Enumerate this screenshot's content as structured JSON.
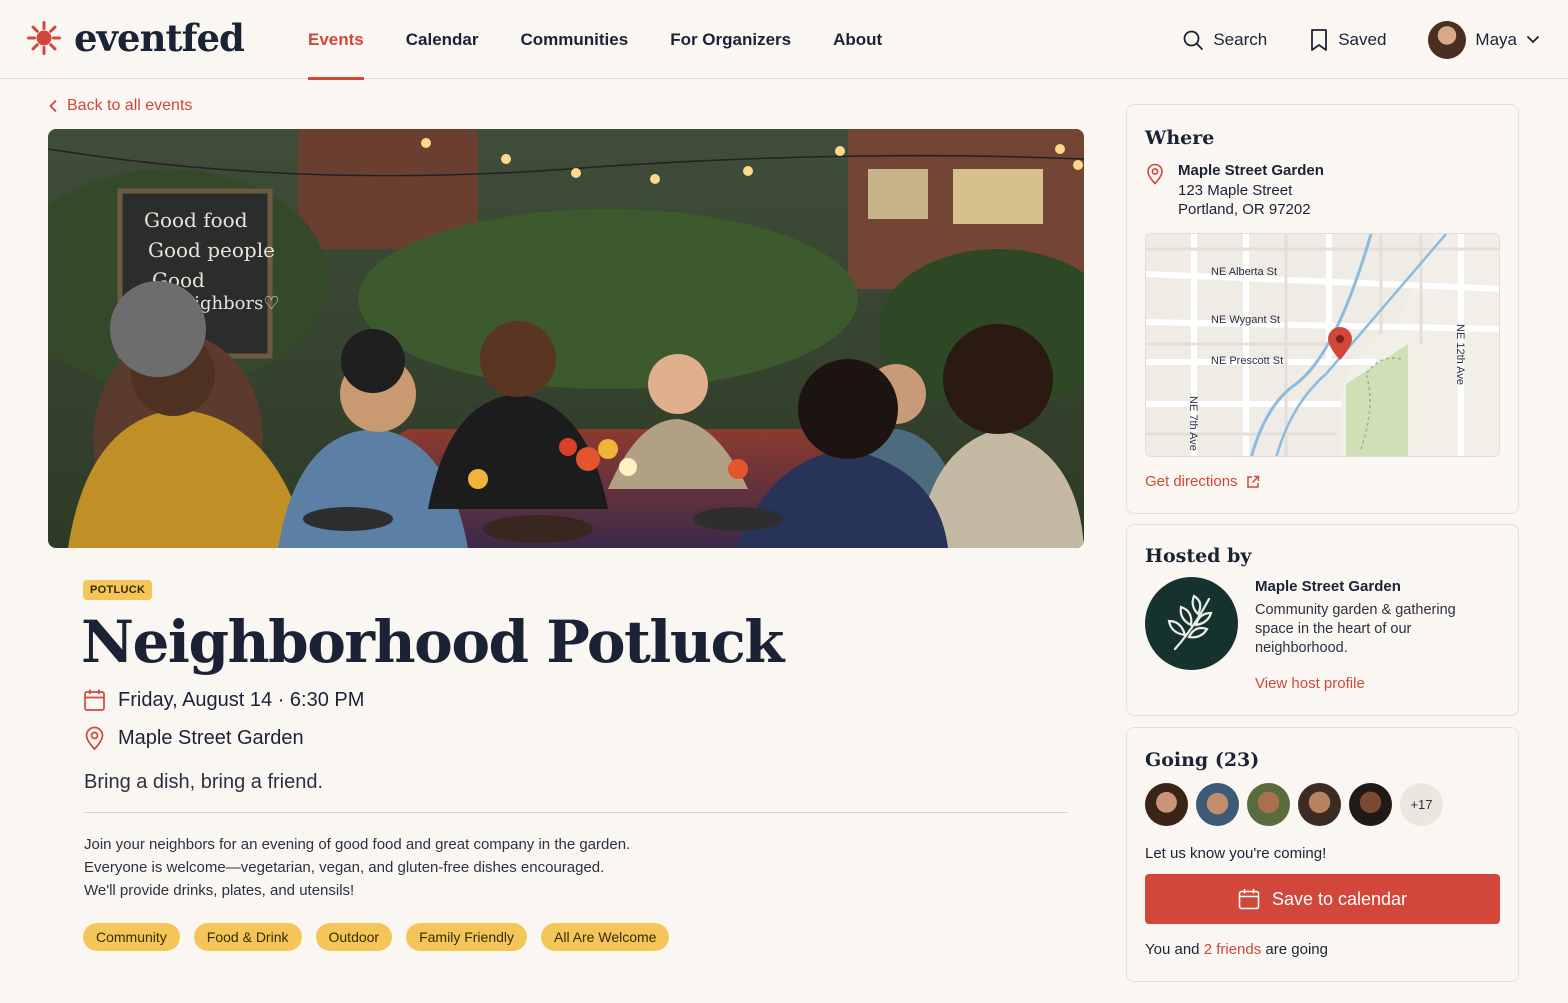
{
  "app": {
    "logo_text": "eventfed"
  },
  "nav": {
    "items": [
      "Events",
      "Calendar",
      "Communities",
      "For Organizers",
      "About"
    ],
    "active": "Events"
  },
  "header": {
    "search_label": "Search",
    "saved_label": "Saved",
    "user_name": "Maya"
  },
  "back_link": "Back to all events",
  "event": {
    "badge": "POTLUCK",
    "title": "Neighborhood Potluck",
    "date_time": "Friday, August 14 · 6:30 PM",
    "location": "Maple Street Garden",
    "tagline": "Bring a dish, bring a friend.",
    "description": [
      "Join your neighbors for an evening of good food and great company in the garden.",
      "Everyone is welcome—vegetarian, vegan, and gluten-free dishes encouraged.",
      "We'll provide drinks, plates, and utensils!"
    ],
    "tags": [
      "Community",
      "Food & Drink",
      "Outdoor",
      "Family Friendly",
      "All Are Welcome"
    ],
    "chalkboard_text": [
      "Good food",
      "Good people",
      "Good",
      "neighbors♡"
    ]
  },
  "where": {
    "title": "Where",
    "venue": "Maple Street Garden",
    "street": "123 Maple Street",
    "city": "Portland, OR 97202",
    "map_labels": {
      "alberta": "NE Alberta St",
      "wygant": "NE Wygant St",
      "prescott": "NE Prescott St",
      "seventh": "NE 7th Ave",
      "twelfth": "NE 12th Ave"
    },
    "directions_label": "Get directions"
  },
  "host": {
    "title": "Hosted by",
    "name": "Maple Street Garden",
    "description": "Community garden & gathering space in the heart of our neighborhood.",
    "profile_link": "View host profile"
  },
  "going": {
    "title": "Going (23)",
    "more_count": "+17",
    "prompt": "Let us know you're coming!",
    "save_button": "Save to calendar",
    "friends_prefix": "You and",
    "friends_link": "2 friends",
    "friends_suffix": "are going"
  },
  "colors": {
    "accent": "#d2473a",
    "tag": "#f4c65a",
    "text": "#1c2236",
    "background": "#faf7f2"
  }
}
